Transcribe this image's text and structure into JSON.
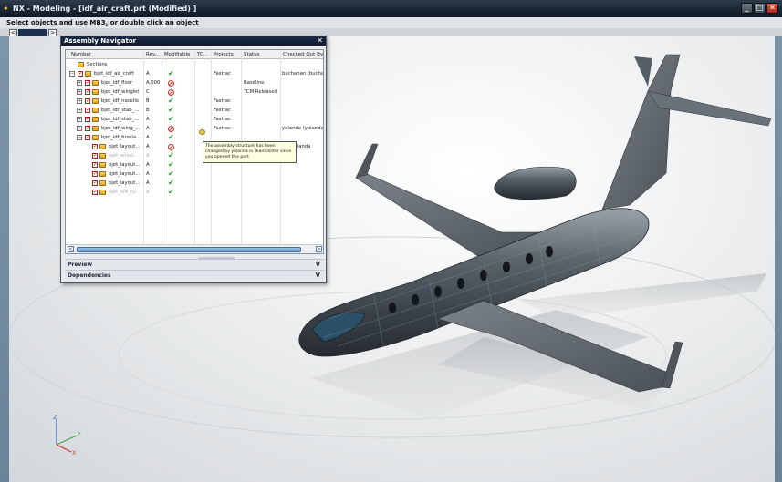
{
  "window": {
    "title": "NX - Modeling - [idf_air_craft.prt (Modified) ]",
    "app_icon": "nx-logo-icon",
    "controls": {
      "minimize": "_",
      "maximize": "□",
      "close": "✕"
    }
  },
  "status_line": "Select objects and use MB3, or double click an object",
  "toolstrip": {
    "scroll_left": "<",
    "scroll_right": ">"
  },
  "navigator": {
    "title": "Assembly Navigator",
    "close": "✕",
    "columns": [
      "Number",
      "Rev...",
      "Modifiable",
      "TC...",
      "Projects",
      "Status",
      "Checked Out By"
    ],
    "rows": [
      {
        "expander": "",
        "checkbox": false,
        "icon": "folder",
        "number": "Sections",
        "rev": "",
        "modifiable": "",
        "projects": "",
        "status": "",
        "checked_out": "",
        "dim": false,
        "indent": 0
      },
      {
        "expander": "−",
        "checkbox": true,
        "icon": "assembly",
        "number": "bjet_idf_air_craft",
        "rev": "A",
        "modifiable": "yes",
        "projects": "Fastrac",
        "status": "",
        "checked_out": "buchanan (bucha",
        "dim": false,
        "indent": 0
      },
      {
        "expander": "+",
        "checkbox": true,
        "icon": "assembly",
        "number": "bjet_idf_floor",
        "rev": "A.000",
        "modifiable": "no",
        "projects": "",
        "status": "Baseline",
        "checked_out": "",
        "dim": false,
        "indent": 1
      },
      {
        "expander": "+",
        "checkbox": true,
        "icon": "assembly",
        "number": "bjet_idf_winglet",
        "rev": "C",
        "modifiable": "no",
        "projects": "",
        "status": "TCM Released",
        "checked_out": "",
        "dim": false,
        "indent": 1
      },
      {
        "expander": "+",
        "checkbox": true,
        "icon": "assembly",
        "number": "bjet_idf_nacelle",
        "rev": "B",
        "modifiable": "yes",
        "projects": "Fastrac",
        "status": "",
        "checked_out": "",
        "dim": false,
        "indent": 1
      },
      {
        "expander": "+",
        "checkbox": true,
        "icon": "assembly",
        "number": "bjet_idf_stab_...",
        "rev": "B",
        "modifiable": "yes",
        "projects": "Fastrac",
        "status": "",
        "checked_out": "",
        "dim": false,
        "indent": 1
      },
      {
        "expander": "+",
        "checkbox": true,
        "icon": "assembly",
        "number": "bjet_idf_stab_...",
        "rev": "A",
        "modifiable": "yes",
        "projects": "Fastrac",
        "status": "",
        "checked_out": "",
        "dim": false,
        "indent": 1
      },
      {
        "expander": "+",
        "checkbox": true,
        "icon": "assembly",
        "number": "bjet_idf_wing_...",
        "rev": "A",
        "modifiable": "no",
        "projects": "Fastrac",
        "status": "",
        "checked_out": "yolanda (yolanda",
        "dim": false,
        "indent": 1
      },
      {
        "expander": "−",
        "checkbox": true,
        "icon": "assembly",
        "number": "bjet_idf_fusela...",
        "rev": "A",
        "modifiable": "yes",
        "projects": "",
        "status": "",
        "checked_out": "",
        "dim": false,
        "indent": 1
      },
      {
        "expander": "",
        "checkbox": true,
        "icon": "part",
        "number": "bjet_layout...",
        "rev": "A",
        "modifiable": "no",
        "projects": "",
        "status": "",
        "checked_out": "da (yolanda",
        "dim": false,
        "indent": 2
      },
      {
        "expander": "",
        "checkbox": true,
        "icon": "part",
        "number": "bjet_envel...",
        "rev": "A",
        "modifiable": "yes",
        "projects": "",
        "status": "",
        "checked_out": "",
        "dim": true,
        "indent": 2
      },
      {
        "expander": "",
        "checkbox": true,
        "icon": "part",
        "number": "bjet_layout...",
        "rev": "A",
        "modifiable": "yes",
        "projects": "",
        "status": "",
        "checked_out": "",
        "dim": false,
        "indent": 2
      },
      {
        "expander": "",
        "checkbox": true,
        "icon": "part",
        "number": "bjet_layout...",
        "rev": "A",
        "modifiable": "yes",
        "projects": "",
        "status": "",
        "checked_out": "",
        "dim": false,
        "indent": 2
      },
      {
        "expander": "",
        "checkbox": true,
        "icon": "part",
        "number": "bjet_layout...",
        "rev": "A",
        "modifiable": "yes",
        "projects": "",
        "status": "",
        "checked_out": "",
        "dim": false,
        "indent": 2
      },
      {
        "expander": "",
        "checkbox": true,
        "icon": "part",
        "number": "bjet_loft_fu...",
        "rev": "A",
        "modifiable": "yes",
        "projects": "",
        "status": "",
        "checked_out": "",
        "dim": true,
        "indent": 2
      }
    ],
    "tooltip": "The assembly structure has been changed by yolanda  in Teamcenter since you opened this part",
    "scroll_left": "<",
    "scroll_right": ">",
    "sections": {
      "preview": "Preview",
      "dependencies": "Dependencies",
      "chevron": "V"
    }
  },
  "triad": {
    "x": "X",
    "y": "Y",
    "z": "Z"
  },
  "colors": {
    "accent": "#23a527",
    "blocked": "#d42a1f",
    "title_bar": "#1b2735"
  }
}
